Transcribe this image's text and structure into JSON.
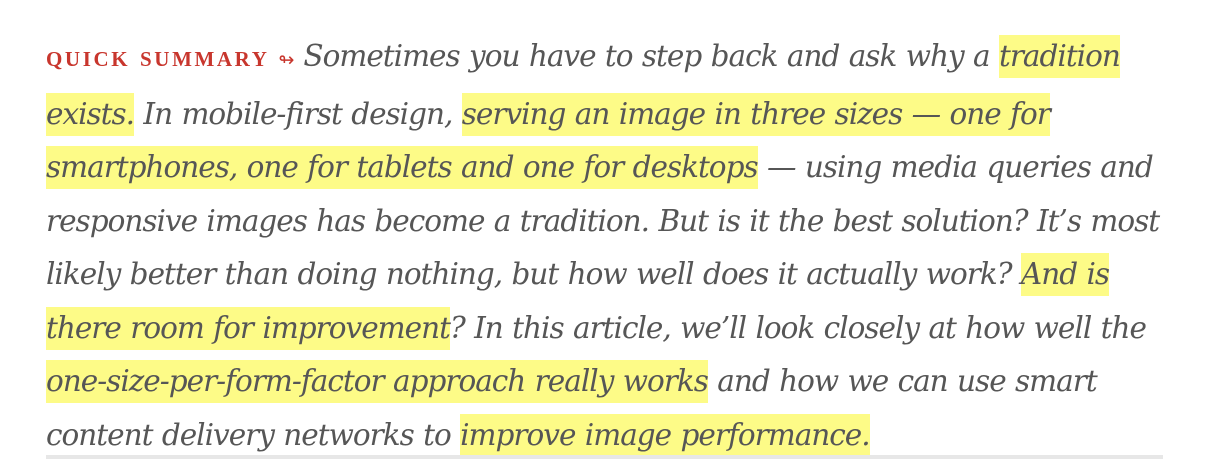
{
  "summary": {
    "label": "Quick Summary",
    "arrow_icon": "squiggly-arrow-icon",
    "segments": [
      {
        "text": "Sometimes you have to step back and ask why a ",
        "highlight": false
      },
      {
        "text": "tradition exists.",
        "highlight": true
      },
      {
        "text": " In mobile-first design, ",
        "highlight": false
      },
      {
        "text": "serving an image in three sizes — one for smartphones, one for tablets and one for desktops",
        "highlight": true
      },
      {
        "text": " — using media queries and responsive images has become a tradition. But is it the best solution? It’s most likely better than doing nothing, but how well does it actually work? ",
        "highlight": false
      },
      {
        "text": "And is there room for improvement",
        "highlight": true
      },
      {
        "text": "? In this article, we’ll look closely at how well the ",
        "highlight": false
      },
      {
        "text": "one-size-per-form-factor approach really works",
        "highlight": true
      },
      {
        "text": " and how we can use smart content delivery networks to ",
        "highlight": false
      },
      {
        "text": "improve image performance.",
        "highlight": true
      }
    ]
  },
  "colors": {
    "label": "#c8362d",
    "text": "#565656",
    "highlight": "#fdfb87",
    "divider": "#e7e7e7"
  }
}
